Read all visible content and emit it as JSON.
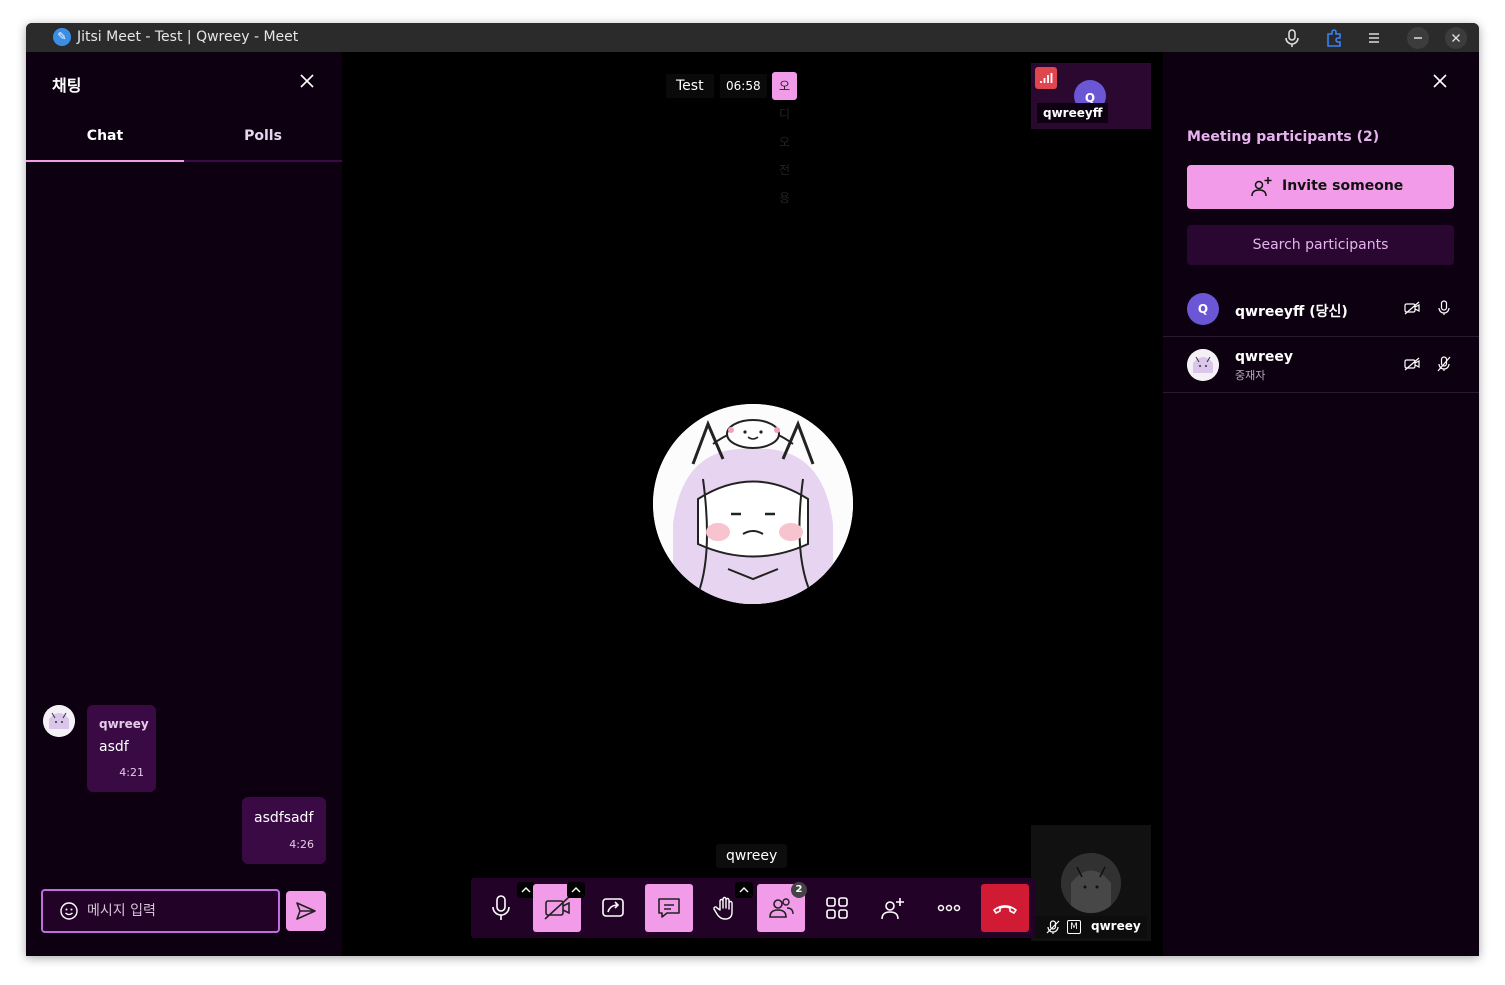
{
  "window": {
    "title": "Jitsi Meet - Test | Qwreey - Meet"
  },
  "chat": {
    "title": "채팅",
    "tabs": [
      "Chat",
      "Polls"
    ],
    "messages": [
      {
        "sender": "qwreey",
        "text": "asdf",
        "time": "4:21"
      },
      {
        "text": "asdfsadf",
        "time": "4:26"
      }
    ],
    "input_placeholder": "메시지 입력"
  },
  "stage": {
    "conference_name": "Test",
    "timer": "06:58",
    "audio_only_label": "오디오 전용",
    "dominant_speaker": "qwreey",
    "thumbnails": [
      {
        "name": "qwreeyff",
        "initial": "Q"
      },
      {
        "name": "qwreey",
        "moderator_badge": "M"
      }
    ],
    "participants_count_badge": "2"
  },
  "participants": {
    "title": "Meeting participants (2)",
    "invite_label": "Invite someone",
    "search_label": "Search participants",
    "list": [
      {
        "name": "qwreeyff (당신)",
        "initial": "Q"
      },
      {
        "name": "qwreey",
        "role": "중재자"
      }
    ]
  },
  "colors": {
    "accent": "#f19be9",
    "panel_bg": "#0d0010",
    "bubble_bg": "#3a0a45",
    "hangup": "#d11b34",
    "avatar_purple": "#6b56d6"
  }
}
